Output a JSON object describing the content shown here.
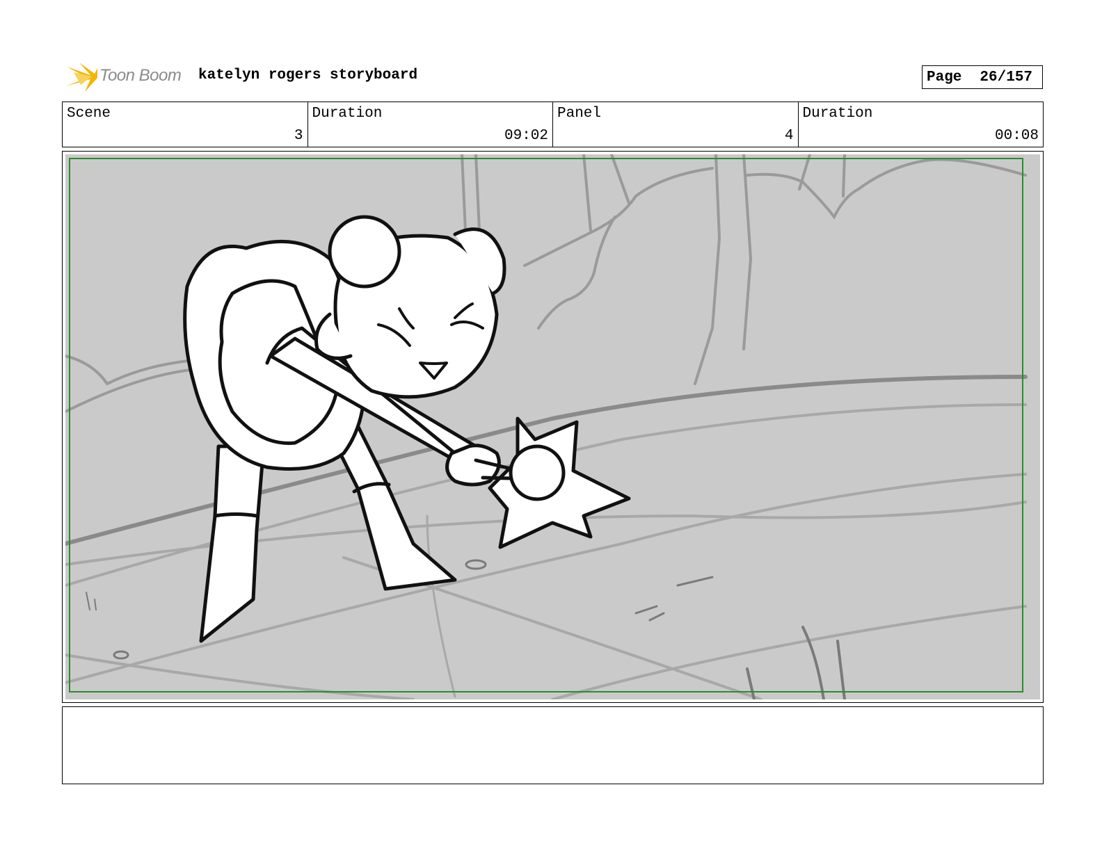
{
  "header": {
    "logo_text": "Toon Boom",
    "title": "katelyn rogers storyboard",
    "page_label": "Page",
    "page_value": "26/157"
  },
  "info": {
    "scene_label": "Scene",
    "scene_value": "3",
    "scene_duration_label": "Duration",
    "scene_duration_value": "09:02",
    "panel_label": "Panel",
    "panel_value": "4",
    "panel_duration_label": "Duration",
    "panel_duration_value": "00:08"
  },
  "colors": {
    "safe_area_border": "#2e8b2e",
    "sketch_background": "#cacaca",
    "logo_accent": "#f2b705"
  }
}
